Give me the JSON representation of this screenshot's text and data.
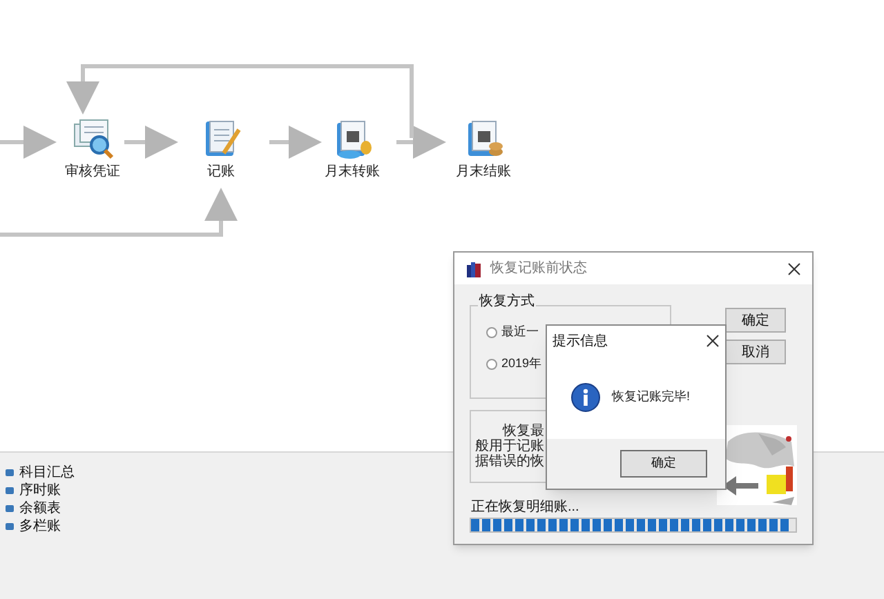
{
  "flow": {
    "nodes": [
      {
        "label": "审核凭证",
        "kind": "review"
      },
      {
        "label": "记账",
        "kind": "post"
      },
      {
        "label": "月末转账",
        "kind": "transfer"
      },
      {
        "label": "月末结账",
        "kind": "close"
      }
    ]
  },
  "side_list": {
    "items": [
      "科目汇总",
      "序时账",
      "余额表",
      "多栏账"
    ]
  },
  "restore_dialog": {
    "title": "恢复记账前状态",
    "group_title": "恢复方式",
    "options": [
      {
        "label": "最近一",
        "selected": false
      },
      {
        "label": "2019年",
        "selected": false
      }
    ],
    "buttons": [
      "确定",
      "取消"
    ],
    "description_lines": [
      "恢复最",
      "般用于记账",
      "据错误的恢"
    ],
    "status": "正在恢复明细账...",
    "progress": {
      "level": 0.98
    },
    "illustration": {
      "kind": "picture"
    }
  },
  "message_box": {
    "title": "提示信息",
    "message": "恢复记账完毕!",
    "button": "确定"
  }
}
